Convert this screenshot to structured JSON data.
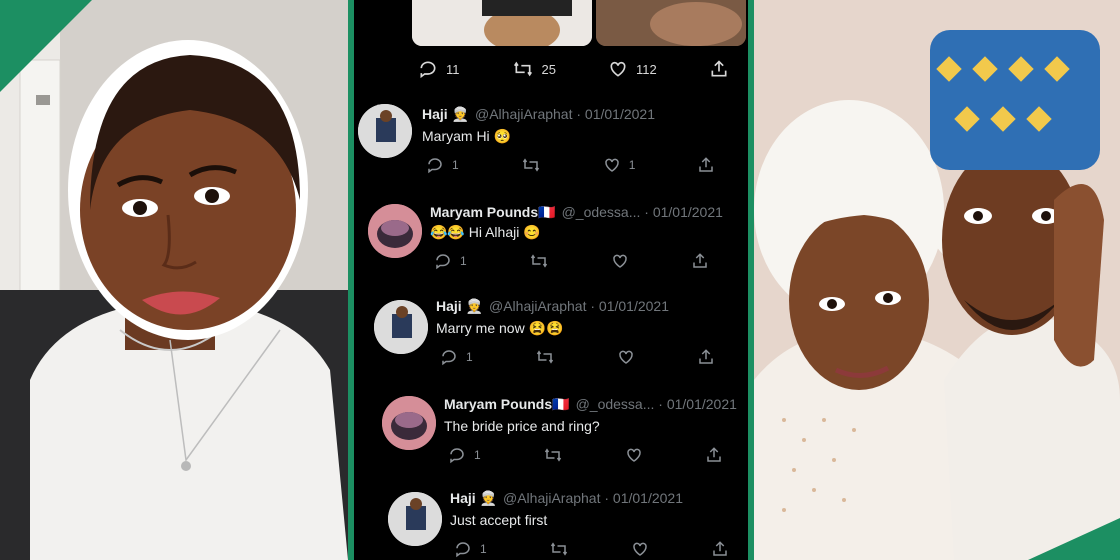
{
  "main_tweet": {
    "stats": {
      "replies": "11",
      "retweets": "25",
      "likes": "112"
    }
  },
  "replies": [
    {
      "name": "Haji 👳",
      "handle": "@AlhajiAraphat · 01/01/2021",
      "text": "Maryam Hi 🥺",
      "reply_count": "1",
      "like_count": "1",
      "avatar": "haji"
    },
    {
      "name": "Maryam Pounds🇲🇫",
      "handle": "@_odessa... · 01/01/2021",
      "text": "😂😂 Hi Alhaji 😊",
      "reply_count": "1",
      "like_count": "",
      "avatar": "maryam"
    },
    {
      "name": "Haji 👳",
      "handle": "@AlhajiAraphat · 01/01/2021",
      "text": "Marry me now 😫😫",
      "reply_count": "1",
      "like_count": "",
      "avatar": "haji"
    },
    {
      "name": "Maryam Pounds🇲🇫",
      "handle": "@_odessa... · 01/01/2021",
      "text": "The bride price and ring?",
      "reply_count": "1",
      "like_count": "",
      "avatar": "maryam"
    },
    {
      "name": "Haji 👳",
      "handle": "@AlhajiAraphat · 01/01/2021",
      "text": "Just accept first",
      "reply_count": "1",
      "like_count": "",
      "avatar": "haji"
    }
  ],
  "colors": {
    "accent": "#1c8f62",
    "background": "#000000",
    "text": "#e7e9ea",
    "muted": "#71767b"
  }
}
